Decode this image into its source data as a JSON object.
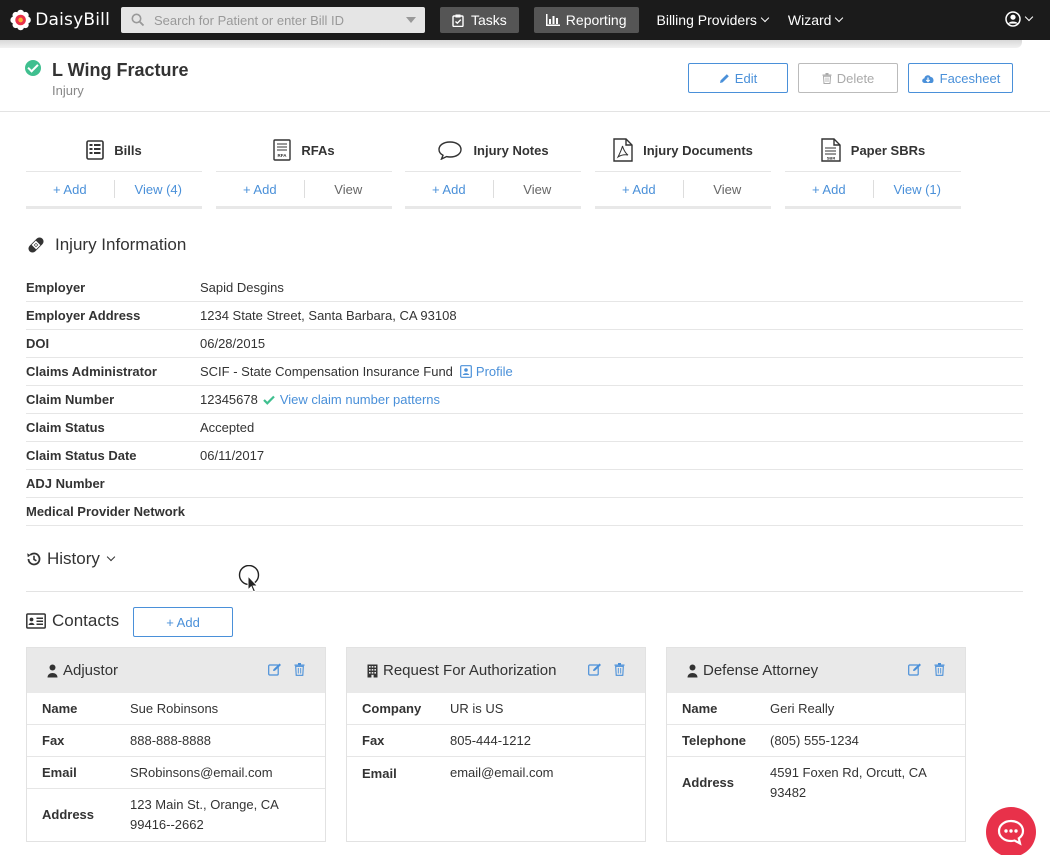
{
  "nav": {
    "brand": "DaisyBill",
    "search_placeholder": "Search for Patient or enter Bill ID",
    "tasks": "Tasks",
    "reporting": "Reporting",
    "billing_providers": "Billing Providers",
    "wizard": "Wizard"
  },
  "injury": {
    "title": "L Wing Fracture",
    "subtitle": "Injury",
    "edit": "Edit",
    "delete": "Delete",
    "facesheet": "Facesheet"
  },
  "actions": [
    {
      "title": "Bills",
      "add": "+ Add",
      "view": "View (4)"
    },
    {
      "title": "RFAs",
      "add": "+ Add",
      "view": "View"
    },
    {
      "title": "Injury Notes",
      "add": "+ Add",
      "view": "View"
    },
    {
      "title": "Injury Documents",
      "add": "+ Add",
      "view": "View"
    },
    {
      "title": "Paper SBRs",
      "add": "+ Add",
      "view": "View (1)"
    }
  ],
  "info": {
    "heading": "Injury Information",
    "rows": [
      {
        "label": "Employer",
        "value": "Sapid Desgins"
      },
      {
        "label": "Employer Address",
        "value": "1234 State Street, Santa Barbara, CA 93108"
      },
      {
        "label": "DOI",
        "value": "06/28/2015"
      },
      {
        "label": "Claims Administrator",
        "value": "SCIF - State Compensation Insurance Fund",
        "link": "Profile"
      },
      {
        "label": "Claim Number",
        "value": "12345678",
        "link": "View claim number patterns"
      },
      {
        "label": "Claim Status",
        "value": "Accepted"
      },
      {
        "label": "Claim Status Date",
        "value": "06/11/2017"
      },
      {
        "label": "ADJ Number",
        "value": ""
      },
      {
        "label": "Medical Provider Network",
        "value": ""
      }
    ]
  },
  "history": {
    "label": "History"
  },
  "contacts": {
    "heading": "Contacts",
    "add": "+ Add",
    "cards": [
      {
        "title": "Adjustor",
        "rows": [
          {
            "label": "Name",
            "value": "Sue Robinsons"
          },
          {
            "label": "Fax",
            "value": "888-888-8888"
          },
          {
            "label": "Email",
            "value": "SRobinsons@email.com"
          },
          {
            "label": "Address",
            "value": "123 Main St., Orange, CA",
            "value2": "99416--2662"
          }
        ]
      },
      {
        "title": "Request For Authorization",
        "rows": [
          {
            "label": "Company",
            "value": "UR is US"
          },
          {
            "label": "Fax",
            "value": "805-444-1212"
          },
          {
            "label": "Email",
            "value": "email@email.com"
          }
        ]
      },
      {
        "title": "Defense Attorney",
        "rows": [
          {
            "label": "Name",
            "value": "Geri Really"
          },
          {
            "label": "Telephone",
            "value": "(805) 555-1234"
          },
          {
            "label": "Address",
            "value": "4591 Foxen Rd, Orcutt, CA",
            "value2": "93482"
          }
        ]
      }
    ]
  },
  "colors": {
    "accent": "#4a90d9",
    "success": "#3fbf8f",
    "chat": "#e8314a",
    "navbar": "#1b1b1b"
  }
}
